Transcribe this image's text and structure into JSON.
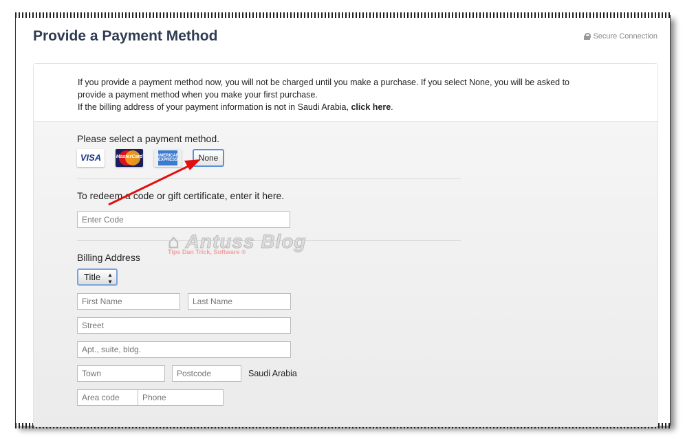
{
  "header": {
    "title": "Provide a Payment Method",
    "secure": "Secure Connection"
  },
  "intro": {
    "line1": "If you provide a payment method now, you will not be charged until you make a purchase. If you select None, you will be asked to",
    "line2": "provide a payment method when you make your first purchase.",
    "line3": "If the billing address of your payment information is not in Saudi Arabia,",
    "link": "click here",
    "period": "."
  },
  "payment": {
    "label": "Please select a payment method.",
    "visa": "VISA",
    "mastercard": "MasterCard",
    "amex": "American Express",
    "none": "None"
  },
  "redeem": {
    "label": "To redeem a code or gift certificate, enter it here.",
    "placeholder": "Enter Code"
  },
  "billing": {
    "label": "Billing Address",
    "title": "Title",
    "first": "First Name",
    "last": "Last Name",
    "street": "Street",
    "apt": "Apt., suite, bldg.",
    "town": "Town",
    "postcode": "Postcode",
    "country": "Saudi Arabia",
    "area": "Area code",
    "phone": "Phone"
  },
  "watermark": {
    "title": "Antuss Blog",
    "tagline": "Tips Dan Trick, Software"
  },
  "colors": {
    "title": "#2f3b52",
    "arrow": "#e01010",
    "selected_border": "#5a8fdc"
  }
}
